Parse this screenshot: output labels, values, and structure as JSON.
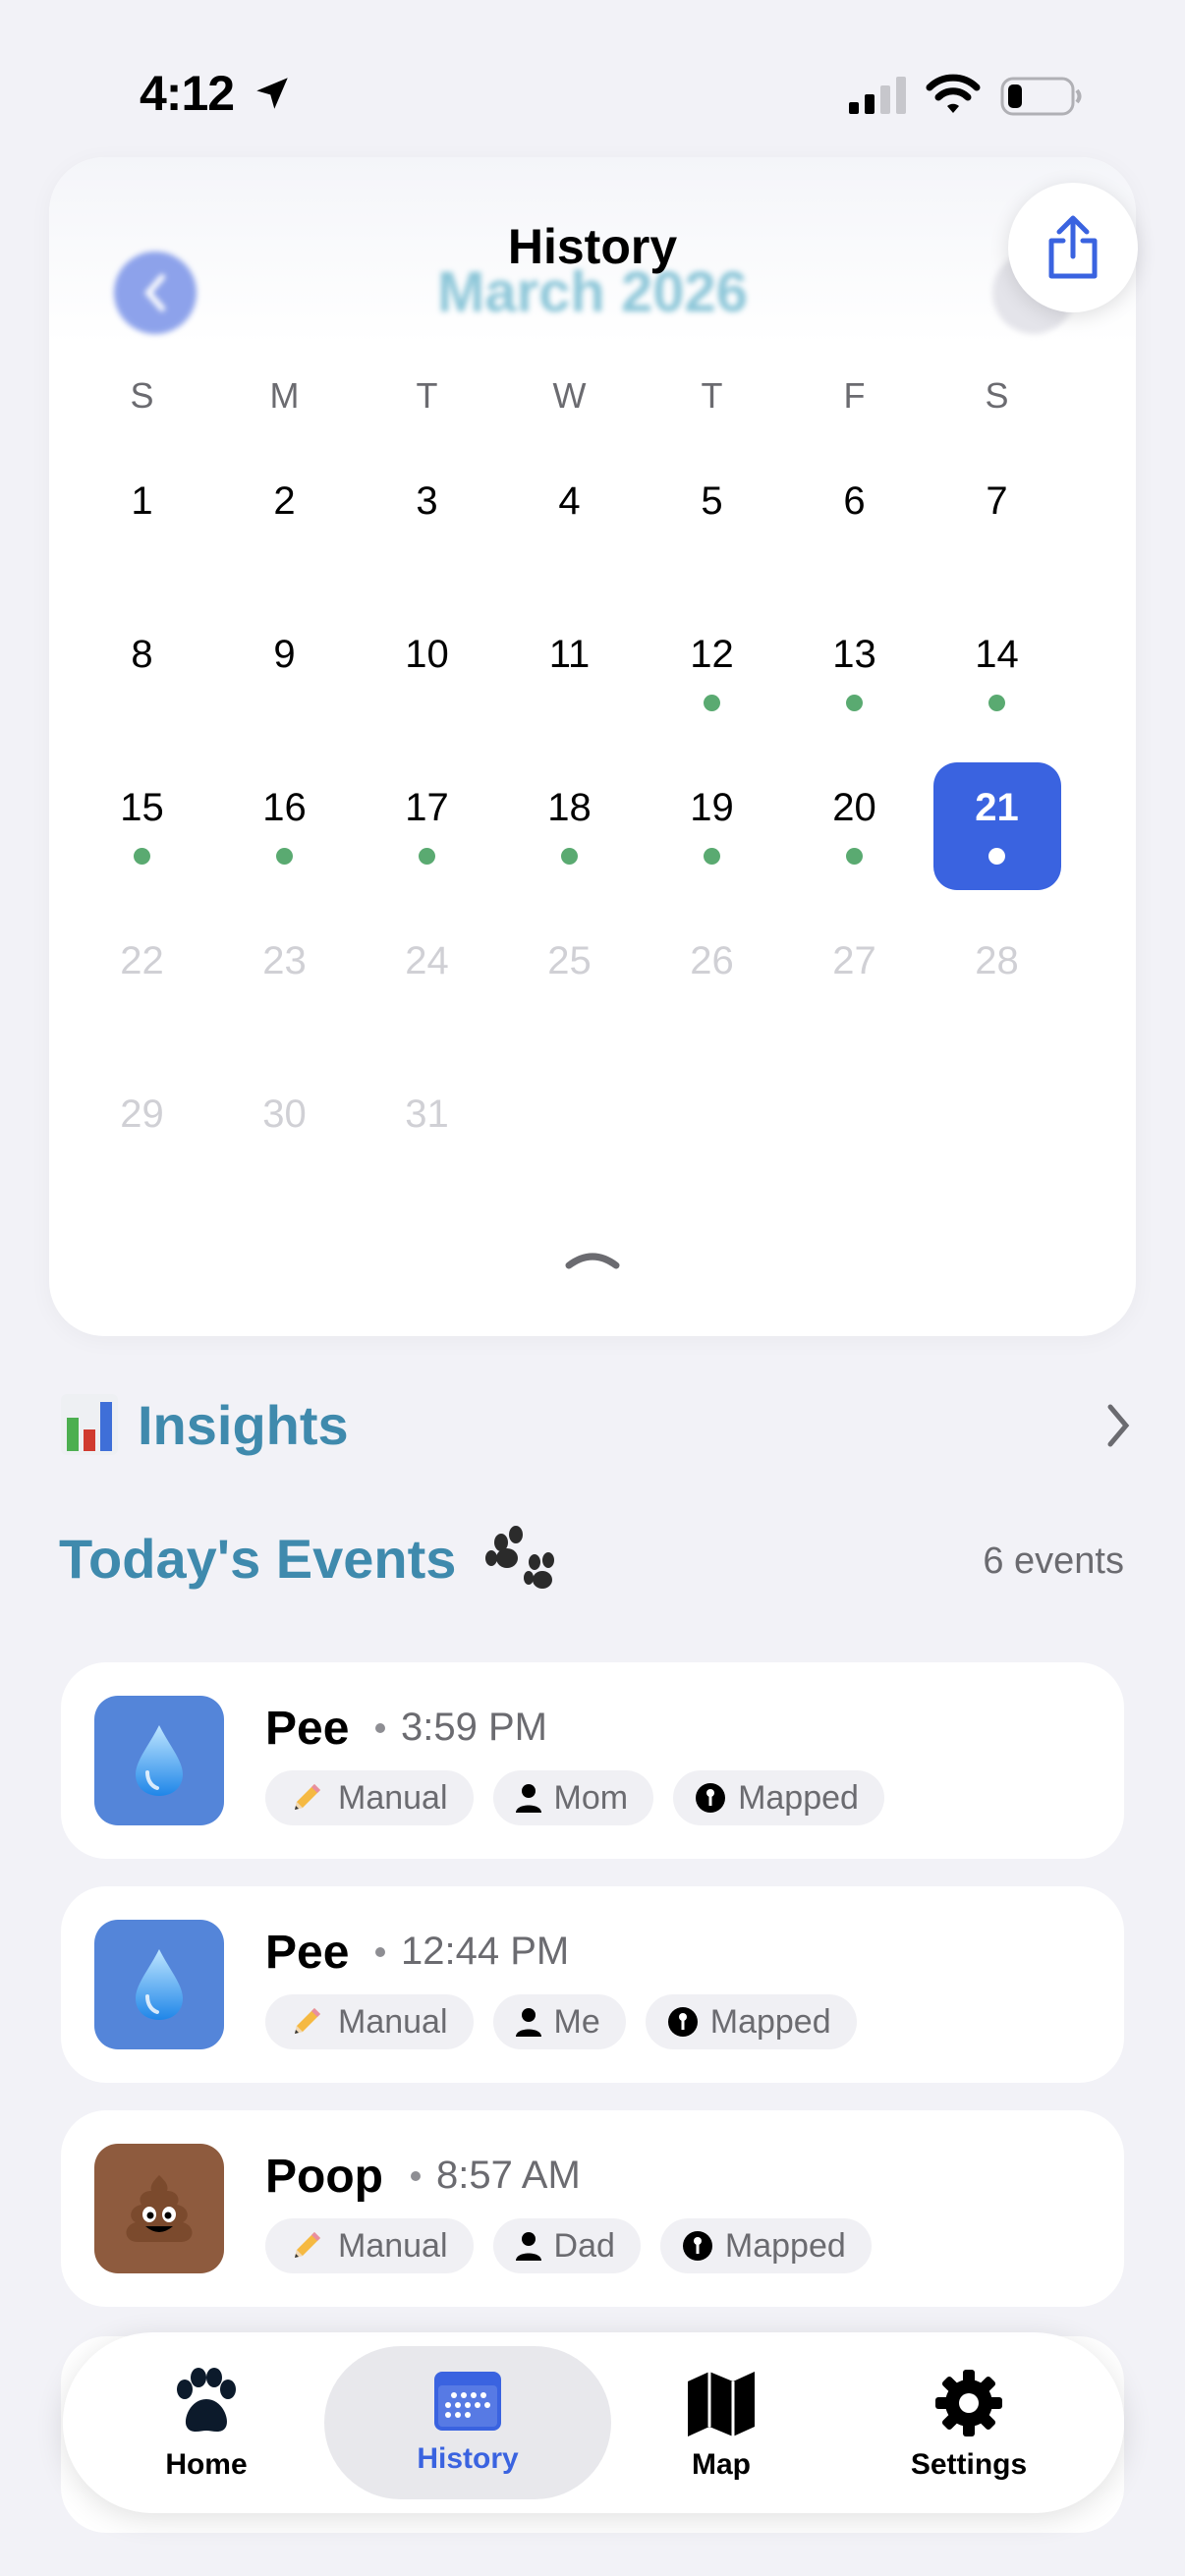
{
  "status_bar": {
    "time": "4:12"
  },
  "header": {
    "title": "History",
    "month": "March 2026"
  },
  "calendar": {
    "weekdays": [
      "S",
      "M",
      "T",
      "W",
      "T",
      "F",
      "S"
    ],
    "days": [
      {
        "n": "1",
        "dot": false,
        "muted": false
      },
      {
        "n": "2",
        "dot": false,
        "muted": false
      },
      {
        "n": "3",
        "dot": false,
        "muted": false
      },
      {
        "n": "4",
        "dot": false,
        "muted": false
      },
      {
        "n": "5",
        "dot": false,
        "muted": false
      },
      {
        "n": "6",
        "dot": false,
        "muted": false
      },
      {
        "n": "7",
        "dot": false,
        "muted": false
      },
      {
        "n": "8",
        "dot": false,
        "muted": false
      },
      {
        "n": "9",
        "dot": false,
        "muted": false
      },
      {
        "n": "10",
        "dot": false,
        "muted": false
      },
      {
        "n": "11",
        "dot": false,
        "muted": false
      },
      {
        "n": "12",
        "dot": true,
        "muted": false
      },
      {
        "n": "13",
        "dot": true,
        "muted": false
      },
      {
        "n": "14",
        "dot": true,
        "muted": false
      },
      {
        "n": "15",
        "dot": true,
        "muted": false
      },
      {
        "n": "16",
        "dot": true,
        "muted": false
      },
      {
        "n": "17",
        "dot": true,
        "muted": false
      },
      {
        "n": "18",
        "dot": true,
        "muted": false
      },
      {
        "n": "19",
        "dot": true,
        "muted": false
      },
      {
        "n": "20",
        "dot": true,
        "muted": false
      },
      {
        "n": "21",
        "dot": true,
        "muted": false,
        "selected": true
      },
      {
        "n": "22",
        "dot": false,
        "muted": true
      },
      {
        "n": "23",
        "dot": false,
        "muted": true
      },
      {
        "n": "24",
        "dot": false,
        "muted": true
      },
      {
        "n": "25",
        "dot": false,
        "muted": true
      },
      {
        "n": "26",
        "dot": false,
        "muted": true
      },
      {
        "n": "27",
        "dot": false,
        "muted": true
      },
      {
        "n": "28",
        "dot": false,
        "muted": true
      },
      {
        "n": "29",
        "dot": false,
        "muted": true
      },
      {
        "n": "30",
        "dot": false,
        "muted": true
      },
      {
        "n": "31",
        "dot": false,
        "muted": true
      }
    ],
    "colors": {
      "selected": "#3a63e0",
      "dot": "#5aaa71"
    }
  },
  "insights": {
    "label": "Insights",
    "icon": "bar-chart-icon"
  },
  "events": {
    "title": "Today's Events",
    "count": "6 events",
    "items": [
      {
        "title": "Pee",
        "time": "3:59 PM",
        "type": "pee",
        "tags": [
          "Manual",
          "Mom",
          "Mapped"
        ]
      },
      {
        "title": "Pee",
        "time": "12:44 PM",
        "type": "pee",
        "tags": [
          "Manual",
          "Me",
          "Mapped"
        ]
      },
      {
        "title": "Poop",
        "time": "8:57 AM",
        "type": "poop",
        "tags": [
          "Manual",
          "Dad",
          "Mapped"
        ]
      }
    ]
  },
  "tab_bar": {
    "items": [
      {
        "label": "Home",
        "icon": "paw-icon"
      },
      {
        "label": "History",
        "icon": "calendar-icon",
        "active": true
      },
      {
        "label": "Map",
        "icon": "map-icon"
      },
      {
        "label": "Settings",
        "icon": "gear-icon"
      }
    ]
  }
}
